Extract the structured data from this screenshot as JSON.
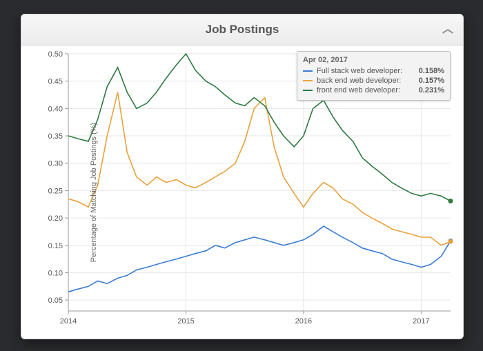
{
  "panel": {
    "title": "Job Postings"
  },
  "ylabel": "Percentage of Matching Job Postings (%)",
  "colors": {
    "full_stack": "#3b7cd4",
    "back_end": "#e9a13b",
    "front_end": "#2e7a3f"
  },
  "tooltip": {
    "date": "Apr 02, 2017",
    "rows": [
      {
        "label": "Full stack web developer:",
        "value": "0.158%",
        "colorKey": "full_stack"
      },
      {
        "label": "back end web developer:",
        "value": "0.157%",
        "colorKey": "back_end"
      },
      {
        "label": "front end web developer:",
        "value": "0.231%",
        "colorKey": "front_end"
      }
    ]
  },
  "chart_data": {
    "type": "line",
    "xlabel": "",
    "ylabel": "Percentage of Matching Job Postings (%)",
    "title": "Job Postings",
    "xlim": [
      2014,
      2017.25
    ],
    "ylim": [
      0.03,
      0.5
    ],
    "yticks": [
      0.05,
      0.1,
      0.15,
      0.2,
      0.25,
      0.3,
      0.35,
      0.4,
      0.45,
      0.5
    ],
    "xticks": [
      2014,
      2015,
      2016,
      2017
    ],
    "grid": true,
    "legend_position": "top-right",
    "x": [
      2014.0,
      2014.08,
      2014.17,
      2014.25,
      2014.33,
      2014.42,
      2014.5,
      2014.58,
      2014.67,
      2014.75,
      2014.83,
      2014.92,
      2015.0,
      2015.08,
      2015.17,
      2015.25,
      2015.33,
      2015.42,
      2015.5,
      2015.58,
      2015.67,
      2015.75,
      2015.83,
      2015.92,
      2016.0,
      2016.08,
      2016.17,
      2016.25,
      2016.33,
      2016.42,
      2016.5,
      2016.58,
      2016.67,
      2016.75,
      2016.83,
      2016.92,
      2017.0,
      2017.08,
      2017.17,
      2017.25
    ],
    "series": [
      {
        "name": "Full stack web developer",
        "colorKey": "full_stack",
        "values": [
          0.065,
          0.07,
          0.075,
          0.085,
          0.08,
          0.09,
          0.095,
          0.105,
          0.11,
          0.115,
          0.12,
          0.125,
          0.13,
          0.135,
          0.14,
          0.15,
          0.145,
          0.155,
          0.16,
          0.165,
          0.16,
          0.155,
          0.15,
          0.155,
          0.16,
          0.17,
          0.185,
          0.175,
          0.165,
          0.155,
          0.145,
          0.14,
          0.135,
          0.125,
          0.12,
          0.115,
          0.11,
          0.115,
          0.13,
          0.158
        ]
      },
      {
        "name": "back end web developer",
        "colorKey": "back_end",
        "values": [
          0.235,
          0.23,
          0.22,
          0.26,
          0.35,
          0.43,
          0.32,
          0.275,
          0.26,
          0.275,
          0.265,
          0.27,
          0.26,
          0.255,
          0.265,
          0.275,
          0.285,
          0.3,
          0.34,
          0.4,
          0.42,
          0.33,
          0.275,
          0.245,
          0.22,
          0.245,
          0.265,
          0.255,
          0.235,
          0.225,
          0.21,
          0.2,
          0.19,
          0.18,
          0.175,
          0.17,
          0.165,
          0.165,
          0.15,
          0.157
        ]
      },
      {
        "name": "front end web developer",
        "colorKey": "front_end",
        "values": [
          0.35,
          0.345,
          0.34,
          0.38,
          0.44,
          0.475,
          0.43,
          0.4,
          0.41,
          0.43,
          0.455,
          0.48,
          0.5,
          0.47,
          0.45,
          0.44,
          0.425,
          0.41,
          0.405,
          0.42,
          0.405,
          0.375,
          0.35,
          0.33,
          0.35,
          0.4,
          0.415,
          0.385,
          0.36,
          0.34,
          0.31,
          0.295,
          0.28,
          0.265,
          0.255,
          0.245,
          0.24,
          0.245,
          0.24,
          0.231
        ]
      }
    ]
  }
}
